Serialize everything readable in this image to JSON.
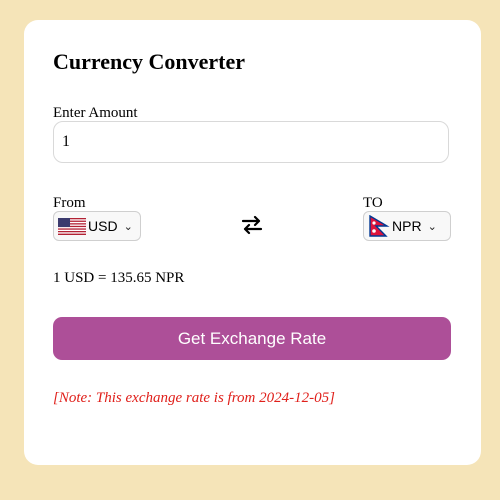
{
  "title": "Currency Converter",
  "amount": {
    "label": "Enter Amount",
    "value": "1"
  },
  "from": {
    "label": "From",
    "currency": "USD",
    "flag_icon": "us-flag-icon"
  },
  "to": {
    "label": "TO",
    "currency": "NPR",
    "flag_icon": "nepal-flag-icon"
  },
  "swap_icon": "swap-arrows-icon",
  "result": "1 USD = 135.65 NPR",
  "button_label": "Get Exchange Rate",
  "note": "[Note: This exchange rate is from 2024-12-05]",
  "colors": {
    "page_background": "#f5e4b8",
    "card_background": "#ffffff",
    "button": "#ad4f98",
    "note_text": "#e0201b"
  }
}
